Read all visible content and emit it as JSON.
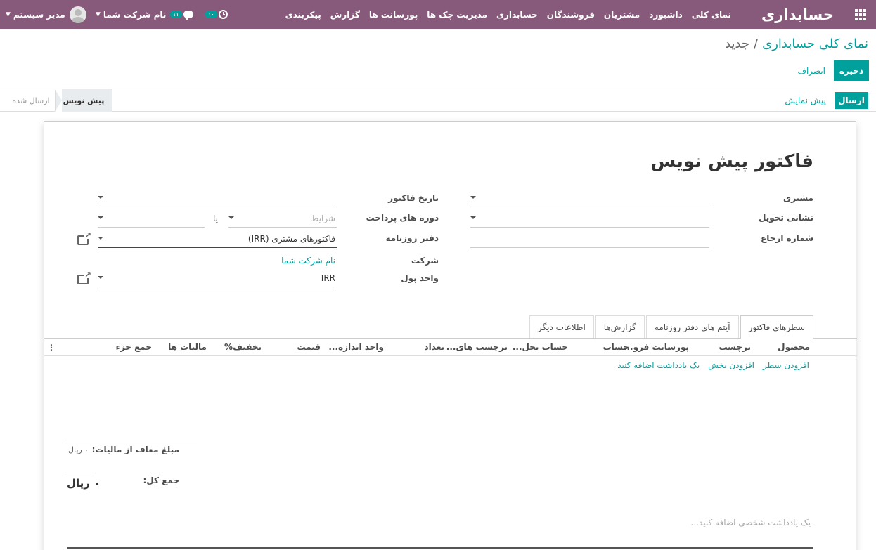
{
  "navbar": {
    "brand": "حسابداری",
    "menu": [
      "نمای کلی",
      "داشبورد",
      "مشتریان",
      "فروشندگان",
      "حسابداری",
      "مدیریت چک ها",
      "پورسانت ها",
      "گزارش",
      "پیکربندی"
    ],
    "activity_count": "۱۰",
    "message_count": "۱۱",
    "company": "نام شرکت شما",
    "user": "مدیر سیستم"
  },
  "breadcrumb": {
    "parent": "نمای کلی حسابداری",
    "separator": "/",
    "current": "جدید"
  },
  "buttons": {
    "save": "ذخیره",
    "discard": "انصراف",
    "send": "ارسال",
    "preview": "پیش نمایش"
  },
  "statusbar": {
    "stages": [
      "پیش نویس",
      "ارسال شده"
    ]
  },
  "form": {
    "title": "فاکتور پیش نویس",
    "customer_label": "مشتری",
    "delivery_label": "نشانی تحویل",
    "reference_label": "شماره ارجاع",
    "invoice_date_label": "تاریخ فاکتور",
    "payment_terms_label": "دوره های پرداخت",
    "terms_placeholder": "شرایط",
    "or_label": "یا",
    "journal_label": "دفتر روزنامه",
    "journal_value": "فاکتورهای مشتری (IRR)",
    "company_label": "شرکت",
    "company_value": "نام شرکت شما",
    "currency_label": "واحد پول",
    "currency_value": "IRR"
  },
  "tabs": [
    "سطرهای فاکتور",
    "آیتم های دفتر روزنامه",
    "گزارش‌ها",
    "اطلاعات دیگر"
  ],
  "lines": {
    "columns": [
      "محصول",
      "برچسب",
      "پورسانت فرو...",
      "حساب",
      "حساب تحل...",
      "برچسب های...",
      "تعداد",
      "واحد اندازه...",
      "قیمت",
      "تخفیف%",
      "مالیات ها",
      "جمع جزء"
    ],
    "menu_icon": "⋮",
    "add_line": "افزودن سطر",
    "add_section": "افزودن بخش",
    "add_note": "یک یادداشت اضافه کنید"
  },
  "totals": {
    "untaxed_label": "مبلغ معاف از مالیات:",
    "untaxed_value": "۰ ریال",
    "total_label": "جمع کل:",
    "total_value": "۰ ریال"
  },
  "note_placeholder": "یک یادداشت شخصی اضافه کنید..."
}
